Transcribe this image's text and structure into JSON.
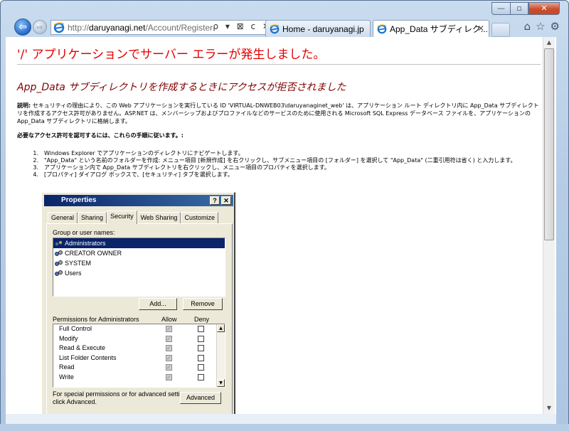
{
  "browser": {
    "url_dim_prefix": "http://",
    "url_host": "daruyanagi.net",
    "url_path": "/Account/Register",
    "address_tools": "ρ ▾ ⊠ c ✕",
    "tabs": [
      {
        "label": "Home - daruyanagi.jp"
      },
      {
        "label": "App_Data サブディレク...",
        "close": "✕"
      }
    ],
    "window_controls": {
      "minimize": "—",
      "maximize": "▫",
      "close": "✕"
    },
    "command_icons": {
      "home": "⌂",
      "favorites": "☆",
      "tools": "⚙"
    },
    "nav": {
      "back": "⇦",
      "forward": "⇨"
    }
  },
  "page": {
    "title": "'/' アプリケーションでサーバー エラーが発生しました。",
    "error_heading": "App_Data サブディレクトリを作成するときにアクセスが拒否されました",
    "description_label": "説明:",
    "description": " セキュリティの理由により、この Web アプリケーションを実行している ID 'VIRTUAL-DNWEB03\\daruyanaginet_web' は、アプリケーション ルート ディレクトリ内に App_Data サブディレクトリを作成するアクセス許可がありません。ASP.NET は、メンバーシップおよびプロファイルなどのサービスのために使用される Microsoft SQL Express データベース ファイルを、アプリケーションの App_Data サブディレクトリに格納します。",
    "steps_heading": "必要なアクセス許可を認可するには、これらの手順に従います。:",
    "steps": [
      {
        "num": "1.",
        "text": "Windows Explorer でアプリケーションのディレクトリにナビゲートします。"
      },
      {
        "num": "2.",
        "text": "\"App_Data\" という名前のフォルダーを作成: メニュー項目 [新規作成] を右クリックし、サブメニュー項目の [フォルダー] を選択して \"App_Data\" (二重引用符は省く) と入力します。"
      },
      {
        "num": "3.",
        "text": "アプリケーション内で App_Data サブディレクトリを右クリックし、メニュー項目のプロパティを選択します。"
      },
      {
        "num": "4.",
        "text": "[プロパティ] ダイアログ ボックスで、[セキュリティ] タブを選択します。"
      }
    ]
  },
  "dialog": {
    "title": "Properties",
    "help_btn": "?",
    "close_btn": "✕",
    "tabs": [
      "General",
      "Sharing",
      "Security",
      "Web Sharing",
      "Customize"
    ],
    "active_tab": "Security",
    "group_label": "Group or user names:",
    "users": [
      "Administrators",
      "CREATOR OWNER",
      "SYSTEM",
      "Users"
    ],
    "selected_user": "Administrators",
    "add_button": "Add...",
    "remove_button": "Remove",
    "permissions_label": "Permissions for Administrators",
    "allow_header": "Allow",
    "deny_header": "Deny",
    "permissions": [
      {
        "name": "Full Control",
        "allow": true,
        "deny": false
      },
      {
        "name": "Modify",
        "allow": true,
        "deny": false
      },
      {
        "name": "Read & Execute",
        "allow": true,
        "deny": false
      },
      {
        "name": "List Folder Contents",
        "allow": true,
        "deny": false
      },
      {
        "name": "Read",
        "allow": true,
        "deny": false
      },
      {
        "name": "Write",
        "allow": true,
        "deny": false
      }
    ],
    "advanced_text_1": "For special permissions or for advanced settings,",
    "advanced_text_2": "click Advanced.",
    "advanced_button": "Advanced"
  },
  "colors": {
    "error_title": "#e40000",
    "error_heading": "#800000",
    "dialog_titlebar": "#0a246a"
  }
}
